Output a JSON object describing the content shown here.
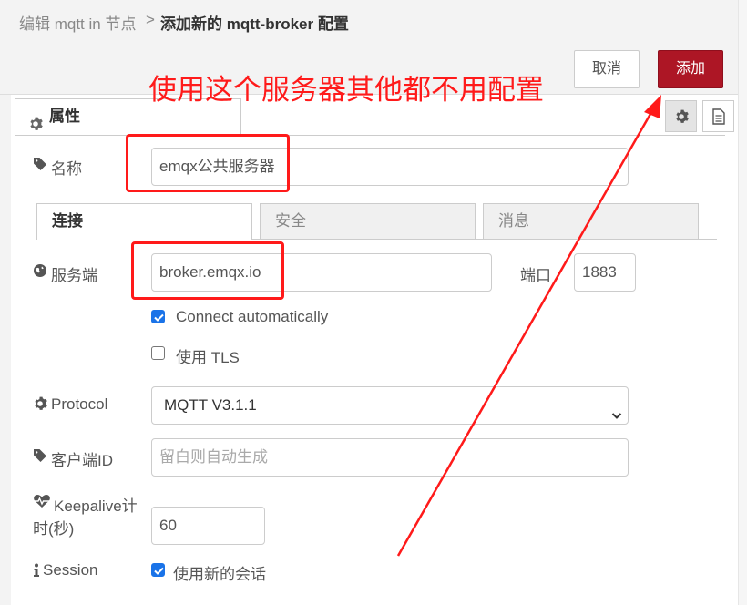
{
  "header": {
    "parent_crumb": "编辑 mqtt in 节点",
    "separator": ">",
    "current_crumb": "添加新的 mqtt-broker 配置"
  },
  "toolbar": {
    "cancel_label": "取消",
    "add_label": "添加"
  },
  "annotation": {
    "text": "使用这个服务器其他都不用配置"
  },
  "panel_tabs": {
    "properties_label": "属性"
  },
  "fields": {
    "name_label": "名称",
    "name_value": "emqx公共服务器",
    "server_label": "服务端",
    "server_value": "broker.emqx.io",
    "port_label": "端口",
    "port_value": "1883",
    "connect_auto_label": "Connect automatically",
    "connect_auto_checked": true,
    "use_tls_label": "使用 TLS",
    "use_tls_checked": false,
    "protocol_label": "Protocol",
    "protocol_value": "MQTT V3.1.1",
    "client_id_label": "客户端ID",
    "client_id_placeholder": "留白则自动生成",
    "keepalive_label_line1": "Keepalive计",
    "keepalive_label_line2": "时(秒)",
    "keepalive_value": "60",
    "session_label": "Session",
    "session_checkbox_label": "使用新的会话",
    "session_checked": true
  },
  "inner_tabs": {
    "connection": "连接",
    "security": "安全",
    "messages": "消息"
  },
  "icons": {
    "properties_tab": "gear-icon",
    "settings_button": "gear-icon",
    "description_button": "document-icon",
    "name": "tag-icon",
    "server": "globe-icon",
    "protocol": "gear-icon",
    "client_id": "tag-icon",
    "keepalive": "heartbeat-icon",
    "session": "info-icon",
    "dropdown": "chevron-down-icon"
  },
  "colors": {
    "primary_button": "#ad1625",
    "annotation": "#ff1a1a",
    "checkbox_checked": "#1a73e8"
  }
}
